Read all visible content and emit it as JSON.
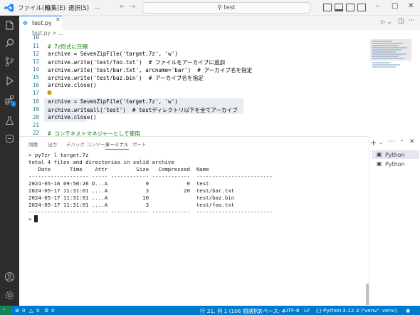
{
  "titlebar": {
    "menu": [
      "ファイル(F)",
      "編集(E)",
      "選択(S)",
      "…"
    ],
    "search": "test"
  },
  "tab": {
    "label": "test.py"
  },
  "breadcrumb": "test.py > ...",
  "editor": {
    "lines": [
      {
        "n": "11",
        "code": "# 7z形式に圧縮"
      },
      {
        "n": "12",
        "code": "archive = SevenZipFile('target.7z', 'w')"
      },
      {
        "n": "13",
        "code": "archive.write('test/foo.txt')  # ファイルをアーカイブに追加"
      },
      {
        "n": "14",
        "code": "archive.write('test/bar.txt', arcname='bar')  # アーカイブ名を指定"
      },
      {
        "n": "15",
        "code": "archive.write('test/baz.bin')  # アーカイブ名を指定"
      },
      {
        "n": "16",
        "code": "archive.close()"
      },
      {
        "n": "17",
        "code": ""
      },
      {
        "n": "18",
        "code": "archive = SevenZipFile('target.7z', 'w')"
      },
      {
        "n": "19",
        "code": "archive.writeall('test')  # testディレクトリ以下を全てアーカイブ"
      },
      {
        "n": "20",
        "code": "archive.close()"
      },
      {
        "n": "21",
        "code": ""
      },
      {
        "n": "22",
        "code": "# コンテキストマネジャーとして使用"
      }
    ],
    "partial_line_number": "10"
  },
  "panel": {
    "tabs": [
      "問題",
      "出力",
      "デバッグ コンソール",
      "ターミナル",
      "ポート"
    ]
  },
  "terminal": {
    "lines": [
      "> py7zr l target.7z",
      "total 4 files and directories in solid archive",
      "   Date      Time    Attr         Size   Compressed  Name",
      "------------------- ----- ------------ ------------  ------------------------",
      "2024-05-16 09:50:26 D...A            0            0  test",
      "2024-05-17 11:31:01 ....A            3           20  test/bar.txt",
      "2024-05-17 11:31:01 ....A           10               test/baz.bin",
      "2024-05-17 11:31:01 ....A            3               test/foo.txt",
      "------------------- ----- ------------ ------------  ------------------------",
      "> "
    ]
  },
  "side_panel": {
    "items": [
      "Python",
      "Python"
    ]
  },
  "status": {
    "errors": "0",
    "warnings": "0",
    "ports": "0",
    "position": "行 21, 列 1 (106 個選択)",
    "spaces": "スペース: 4",
    "encoding": "UTF-8",
    "eol": "LF",
    "language": "Python",
    "interpreter": "3.12.3 ('venv': venv)"
  }
}
